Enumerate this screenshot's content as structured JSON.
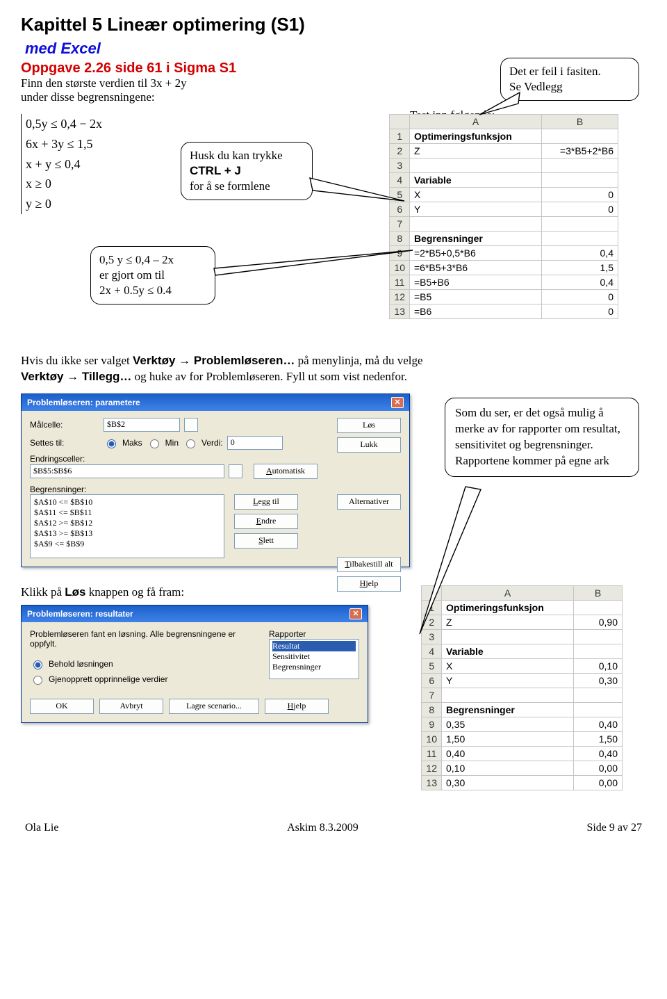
{
  "title": "Kapittel 5 Lineær optimering (S1)",
  "subtitle": "med Excel",
  "task_ref": "Oppgave 2.26 side 61 i Sigma S1",
  "task_line1": "Finn den største verdien til 3x + 2y",
  "task_line2": "under disse begrensningene:",
  "callout_feil": {
    "l1": "Det er feil i fasiten.",
    "l2": "Se Vedlegg"
  },
  "constraints": [
    "0,5y ≤ 0,4 − 2x",
    "6x + 3y ≤ 1,5",
    "x + y ≤ 0,4",
    "x ≥ 0",
    "y ≥ 0"
  ],
  "callout_ctrl": {
    "l1": "Husk du kan trykke",
    "l2_pre": "",
    "l2_bold": "CTRL + J",
    "l3": "for å se formlene"
  },
  "callout_rewrite": {
    "l1": "0,5 y ≤ 0,4 – 2x",
    "l2": "er gjort om til",
    "l3": "2x + 0.5y ≤ 0.4"
  },
  "tast_inn": "Tast inn følgende:",
  "excel1": {
    "headers": [
      "",
      "A",
      "B"
    ],
    "rows": [
      [
        "1",
        "Optimeringsfunksjon",
        ""
      ],
      [
        "2",
        "Z",
        "=3*B5+2*B6"
      ],
      [
        "3",
        "",
        ""
      ],
      [
        "4",
        "Variable",
        ""
      ],
      [
        "5",
        "X",
        "0"
      ],
      [
        "6",
        "Y",
        "0"
      ],
      [
        "7",
        "",
        ""
      ],
      [
        "8",
        "Begrensninger",
        ""
      ],
      [
        "9",
        "=2*B5+0,5*B6",
        "0,4"
      ],
      [
        "10",
        "=6*B5+3*B6",
        "1,5"
      ],
      [
        "11",
        "=B5+B6",
        "0,4"
      ],
      [
        "12",
        "=B5",
        "0"
      ],
      [
        "13",
        "=B6",
        "0"
      ]
    ],
    "bold_rows": [
      0,
      3,
      7
    ]
  },
  "para_mid": {
    "pre": "Hvis du ikke ser valget ",
    "b1": "Verktøy",
    "arr": " → ",
    "b2": "Problemløseren…",
    "mid": " på menylinja, må du velge ",
    "b3": "Verktøy",
    "b4": "Tillegg…",
    "tail": " og huke av for Problemløseren. Fyll ut som vist nedenfor."
  },
  "solver1": {
    "title": "Problemløseren: parametere",
    "labels": {
      "mal": "Målcelle:",
      "settes": "Settes til:",
      "maks": "Maks",
      "min": "Min",
      "verdi": "Verdi:",
      "endr": "Endringsceller:",
      "begr": "Begrensninger:"
    },
    "mal_val": "$B$2",
    "verdi_val": "0",
    "endr_val": "$B$5:$B$6",
    "constraints": [
      "$A$10 <= $B$10",
      "$A$11 <= $B$11",
      "$A$12 >= $B$12",
      "$A$13 >= $B$13",
      "$A$9 <= $B$9"
    ],
    "buttons": {
      "los": "Løs",
      "lukk": "Lukk",
      "auto": "Automatisk",
      "alt": "Alternativer",
      "legg": "Legg til",
      "endre": "Endre",
      "slett": "Slett",
      "tilb": "Tilbakestill alt",
      "hjelp": "Hjelp"
    }
  },
  "callout_reports": {
    "p1": "Som du ser, er det også mulig å merke av for rapporter om resultat, sensitivitet og begrensninger. Rapportene kommer på egne ark"
  },
  "klikk_txt_pre": "Klikk på ",
  "klikk_txt_b": "Løs",
  "klikk_txt_post": " knappen og få fram:",
  "solver2": {
    "title": "Problemløseren: resultater",
    "msg": "Problemløseren fant en løsning. Alle begrensningene er oppfylt.",
    "opt1": "Behold løsningen",
    "opt2": "Gjenopprett opprinnelige verdier",
    "rap_label": "Rapporter",
    "reports": [
      "Resultat",
      "Sensitivitet",
      "Begrensninger"
    ],
    "buttons": {
      "ok": "OK",
      "avbryt": "Avbryt",
      "lagre": "Lagre scenario...",
      "hjelp": "Hjelp"
    }
  },
  "excel2": {
    "headers": [
      "",
      "A",
      "B"
    ],
    "rows": [
      [
        "1",
        "Optimeringsfunksjon",
        ""
      ],
      [
        "2",
        "Z",
        "0,90"
      ],
      [
        "3",
        "",
        ""
      ],
      [
        "4",
        "Variable",
        ""
      ],
      [
        "5",
        "X",
        "0,10"
      ],
      [
        "6",
        "Y",
        "0,30"
      ],
      [
        "7",
        "",
        ""
      ],
      [
        "8",
        "Begrensninger",
        ""
      ],
      [
        "9",
        "0,35",
        "0,40"
      ],
      [
        "10",
        "1,50",
        "1,50"
      ],
      [
        "11",
        "0,40",
        "0,40"
      ],
      [
        "12",
        "0,10",
        "0,00"
      ],
      [
        "13",
        "0,30",
        "0,00"
      ]
    ],
    "bold_rows": [
      0,
      3,
      7
    ]
  },
  "footer": {
    "left": "Ola Lie",
    "mid": "Askim 8.3.2009",
    "right": "Side 9 av 27"
  }
}
